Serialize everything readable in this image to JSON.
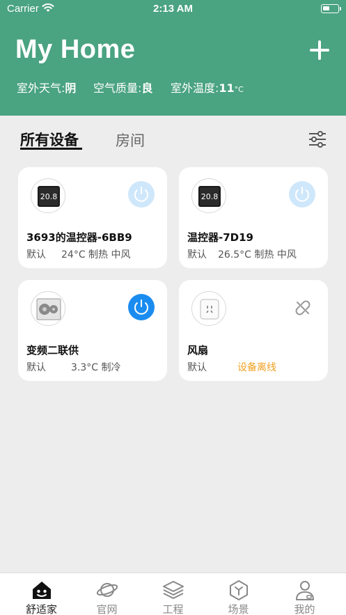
{
  "status_bar": {
    "carrier": "Carrier",
    "time": "2:13 AM"
  },
  "header": {
    "title": "My Home",
    "weather_label": "室外天气:",
    "weather_value": "阴",
    "air_label": "空气质量:",
    "air_value": "良",
    "temp_label": "室外温度:",
    "temp_value": "11",
    "temp_unit": "°C",
    "add_icon": "plus-icon"
  },
  "tabs": [
    {
      "label": "所有设备",
      "active": true
    },
    {
      "label": "房间",
      "active": false
    }
  ],
  "filter_icon": "sliders-icon",
  "devices": [
    {
      "name": "3693的温控器-6BB9",
      "room": "默认",
      "status": "24°C 制热 中风",
      "power": "off",
      "icon": "thermostat-icon",
      "display": "20.8"
    },
    {
      "name": "温控器-7D19",
      "room": "默认",
      "status": "26.5°C 制热 中风",
      "power": "off",
      "icon": "thermostat-icon",
      "display": "20.8"
    },
    {
      "name": "变频二联供",
      "room": "默认",
      "status": "3.3°C 制冷",
      "power": "on",
      "icon": "heat-pump-icon"
    },
    {
      "name": "风扇",
      "room": "默认",
      "status": "设备离线",
      "power": "offline",
      "icon": "smart-plug-icon"
    }
  ],
  "colors": {
    "brand": "#4aa381",
    "power_on": "#1a8cf0",
    "power_off": "#cfe7fb",
    "offline": "#f0a020"
  },
  "nav": [
    {
      "label": "舒适家",
      "icon": "home-icon",
      "active": true
    },
    {
      "label": "官网",
      "icon": "planet-icon",
      "active": false
    },
    {
      "label": "工程",
      "icon": "layers-icon",
      "active": false
    },
    {
      "label": "场景",
      "icon": "cube-icon",
      "active": false
    },
    {
      "label": "我的",
      "icon": "user-icon",
      "active": false
    }
  ]
}
